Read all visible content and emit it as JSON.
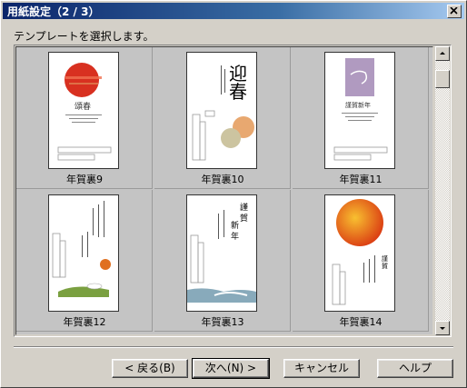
{
  "window": {
    "title": "用紙設定（2 / 3）"
  },
  "instruction": "テンプレートを選択します。",
  "templates": [
    {
      "label": "年賀裏9",
      "accent": "#d83020",
      "kanji": "頌春"
    },
    {
      "label": "年賀裏10",
      "accent": "#000000",
      "kanji": "迎春"
    },
    {
      "label": "年賀裏11",
      "accent": "#b09ac0",
      "kanji": "謹賀新年"
    },
    {
      "label": "年賀裏12",
      "accent": "#e07020",
      "kanji": ""
    },
    {
      "label": "年賀裏13",
      "accent": "#88aabb",
      "kanji": "謹賀新年"
    },
    {
      "label": "年賀裏14",
      "accent": "#e84818",
      "kanji": "謹賀新年"
    }
  ],
  "buttons": {
    "back_label": "< 戻る(B)",
    "next_label": "次へ(N) >",
    "cancel_label": "キャンセル",
    "help_label": "ヘルプ"
  }
}
